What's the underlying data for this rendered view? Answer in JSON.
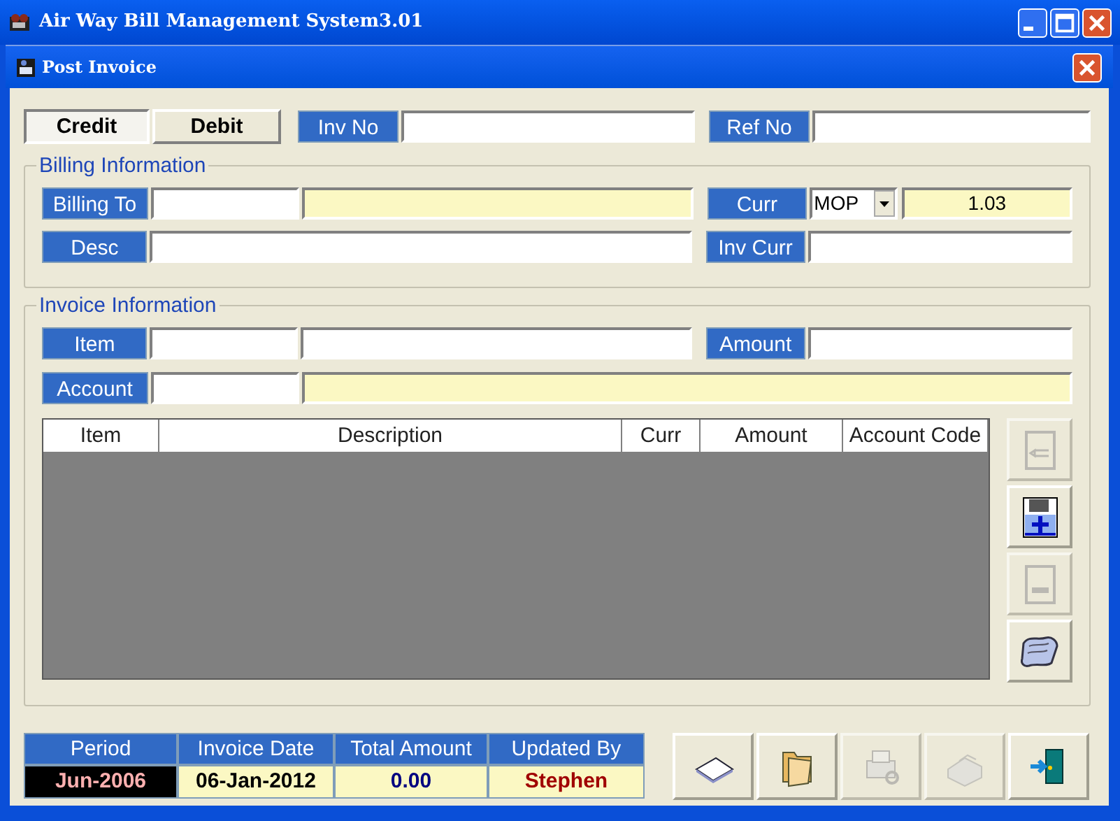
{
  "window": {
    "title": "Air Way Bill Management System3.01"
  },
  "dialog": {
    "title": "Post Invoice"
  },
  "mode_buttons": [
    {
      "label": "Credit",
      "selected": true
    },
    {
      "label": "Debit",
      "selected": false
    }
  ],
  "header_fields": [
    {
      "label": "Inv No"
    },
    {
      "label": "Ref No"
    }
  ],
  "billing": {
    "title": "Billing Information",
    "billing_to_label": "Billing To",
    "curr_label": "Curr",
    "currency": "MOP",
    "rate": "1.03",
    "desc_label": "Desc",
    "inv_curr_label": "Inv Curr"
  },
  "invoice": {
    "title": "Invoice Information",
    "item_label": "Item",
    "amount_label": "Amount",
    "account_label": "Account",
    "columns": [
      "Item",
      "Description",
      "Curr",
      "Amount",
      "Account Code"
    ]
  },
  "side_buttons": [
    {
      "kind": "edit",
      "disabled": true
    },
    {
      "kind": "add",
      "disabled": false
    },
    {
      "kind": "remove",
      "disabled": true
    },
    {
      "kind": "scroll",
      "disabled": false
    }
  ],
  "summary": {
    "columns": [
      "Period",
      "Invoice Date",
      "Total Amount",
      "Updated By"
    ],
    "values": [
      "Jun-2006",
      "06-Jan-2012",
      "0.00",
      "Stephen"
    ]
  },
  "actions": [
    {
      "kind": "new",
      "disabled": false
    },
    {
      "kind": "open",
      "disabled": false
    },
    {
      "kind": "preview",
      "disabled": true
    },
    {
      "kind": "print",
      "disabled": true
    },
    {
      "kind": "exit",
      "disabled": false
    }
  ]
}
